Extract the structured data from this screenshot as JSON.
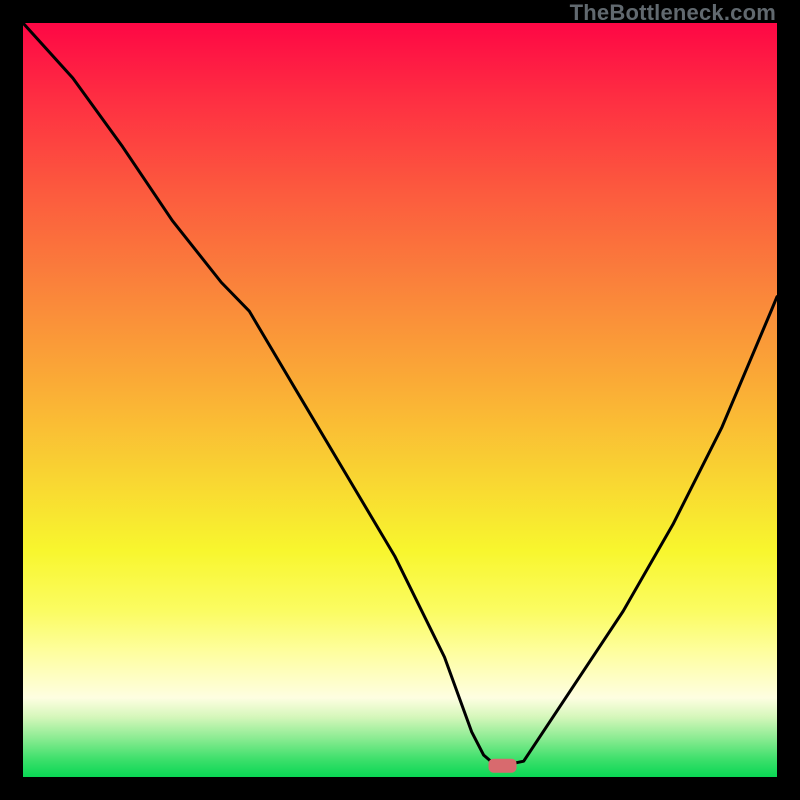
{
  "watermark": "TheBottleneck.com",
  "chart_data": {
    "type": "line",
    "title": "",
    "xlabel": "",
    "ylabel": "",
    "xlim": [
      0,
      100
    ],
    "ylim": [
      0,
      100
    ],
    "series": [
      {
        "name": "bottleneck-curve",
        "x": [
          0.0,
          6.6,
          13.2,
          19.8,
          26.3,
          30.0,
          36.1,
          42.7,
          49.3,
          55.9,
          59.5,
          61.1,
          62.5,
          63.6,
          66.4,
          79.6,
          86.2,
          92.7,
          99.3,
          100.0
        ],
        "y": [
          100.0,
          92.7,
          83.6,
          73.8,
          65.6,
          61.8,
          51.5,
          40.4,
          29.3,
          15.9,
          6.0,
          2.9,
          1.7,
          1.5,
          2.1,
          22.0,
          33.5,
          46.4,
          62.0,
          63.7
        ]
      }
    ],
    "marker": {
      "name": "optimal-point",
      "x": 63.6,
      "y": 1.5,
      "color": "#d86a6e",
      "shape": "rounded-rect"
    },
    "background_gradient": {
      "stops": [
        {
          "offset": 0.0,
          "color": "#fe0745"
        },
        {
          "offset": 0.1,
          "color": "#fe2e42"
        },
        {
          "offset": 0.22,
          "color": "#fc593e"
        },
        {
          "offset": 0.35,
          "color": "#fa833b"
        },
        {
          "offset": 0.48,
          "color": "#faac36"
        },
        {
          "offset": 0.6,
          "color": "#f9d432"
        },
        {
          "offset": 0.7,
          "color": "#f8f62e"
        },
        {
          "offset": 0.78,
          "color": "#fbfc62"
        },
        {
          "offset": 0.84,
          "color": "#fefea5"
        },
        {
          "offset": 0.895,
          "color": "#fefee1"
        },
        {
          "offset": 0.92,
          "color": "#d6f7bb"
        },
        {
          "offset": 0.95,
          "color": "#87eb90"
        },
        {
          "offset": 0.975,
          "color": "#41e06d"
        },
        {
          "offset": 1.0,
          "color": "#09d754"
        }
      ]
    }
  }
}
